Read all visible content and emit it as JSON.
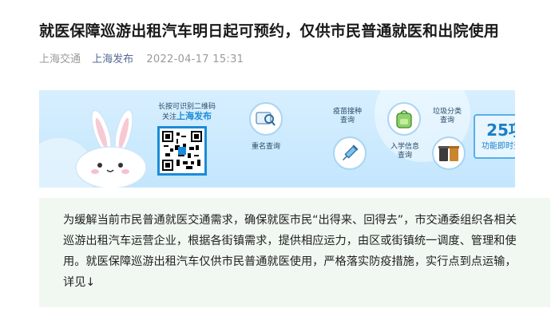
{
  "article": {
    "title": "就医保障巡游出租汽车明日起可预约，仅供市民普通就医和出院使用",
    "source": "上海交通",
    "account": "上海发布",
    "datetime": "2022-04-17 15:31"
  },
  "banner": {
    "qr_hint_line1": "长按可识别二维码",
    "qr_hint_line2_prefix": "关注",
    "qr_hint_brand": "上海发布",
    "services": [
      {
        "label": "重名查询",
        "icon": "magnifier-card-icon"
      },
      {
        "label": "疫苗接种\n查询",
        "icon": "syringe-icon"
      },
      {
        "label": "入学信息\n查询",
        "icon": "schoolbag-icon"
      },
      {
        "label": "垃圾分类\n查询",
        "icon": "trash-bins-icon"
      }
    ],
    "count_number": "25项",
    "count_label": "功能即时查询",
    "colors": {
      "accent": "#1a8bd8",
      "bg_top": "#d7efff"
    }
  },
  "body": {
    "paragraph": "为缓解当前市民普通就医交通需求，确保就医市民“出得来、回得去”，市交通委组织各相关巡游出租汽车运营企业，根据各街镇需求，提供相应运力，由区或街镇统一调度、管理和使用。就医保障巡游出租汽车仅供市民普通就医使用，严格落实防疫措施，实行点到点运输，详见↓"
  }
}
